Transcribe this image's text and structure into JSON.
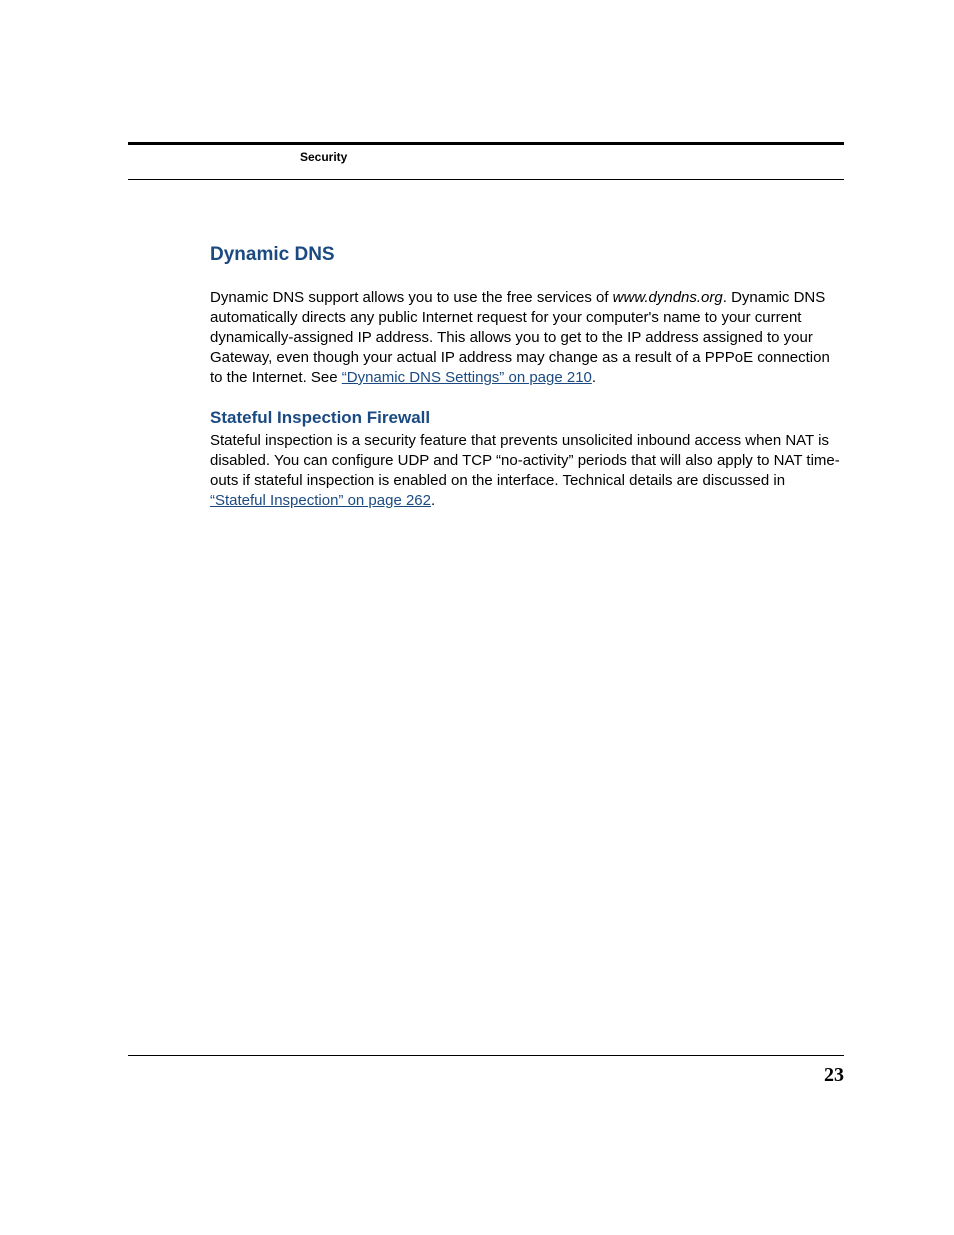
{
  "header": {
    "section_label": "Security"
  },
  "sections": {
    "dynamic_dns": {
      "title": "Dynamic DNS",
      "para_pre": "Dynamic DNS support allows you to use the free services of ",
      "site_italic": "www.dyndns.org",
      "para_mid": ". Dynamic DNS automatically directs any public Internet request for your computer's name to your current dynamically-assigned IP address. This allows you to get to the IP address assigned to your Gateway, even though your actual IP address may change as a result of a PPPoE connection to the Internet. See ",
      "link_text": "“Dynamic DNS Settings” on page 210",
      "para_post": "."
    },
    "stateful": {
      "title": "Stateful Inspection Firewall",
      "para_pre": "Stateful inspection is a security feature that prevents unsolicited inbound access when NAT is disabled. You can configure UDP and TCP “no-activity” periods that will also apply to NAT time-outs if stateful inspection is enabled on the interface. Technical details are discussed in ",
      "link_text": "“Stateful Inspection” on page 262",
      "para_post": "."
    }
  },
  "footer": {
    "page_number": "23"
  }
}
